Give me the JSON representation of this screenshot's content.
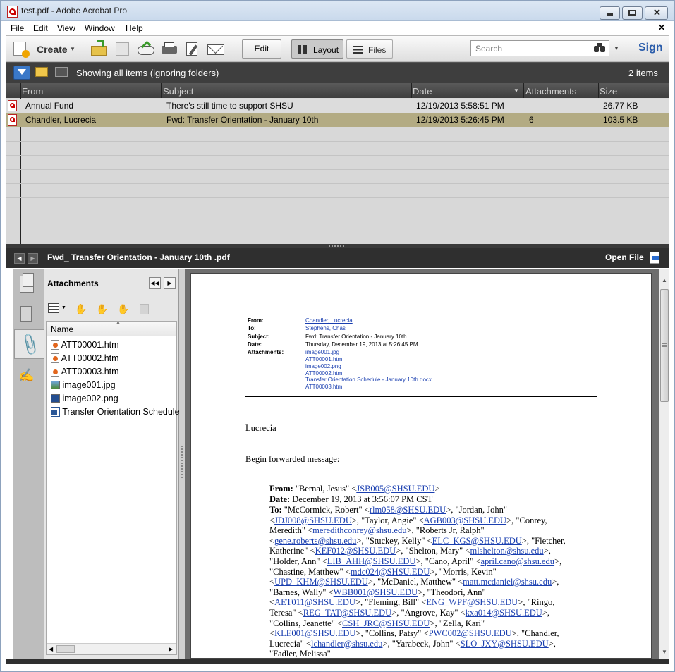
{
  "window": {
    "title": "test.pdf - Adobe Acrobat Pro"
  },
  "menu": [
    "File",
    "Edit",
    "View",
    "Window",
    "Help"
  ],
  "toolbar": {
    "create_label": "Create",
    "edit_label": "Edit",
    "layout_label": "Layout",
    "files_label": "Files",
    "search_placeholder": "Search",
    "sign_label": "Sign"
  },
  "filterbar": {
    "status": "Showing all items (ignoring folders)",
    "count": "2 items"
  },
  "list": {
    "columns": [
      "From",
      "Subject",
      "Date",
      "Attachments",
      "Size"
    ],
    "rows": [
      {
        "from": "Annual Fund",
        "subject": "There's still time to support SHSU",
        "date": "12/19/2013 5:58:51 PM",
        "attachments": "",
        "size": "26.77 KB",
        "selected": false
      },
      {
        "from": "Chandler, Lucrecia",
        "subject": "Fwd: Transfer Orientation - January 10th",
        "date": "12/19/2013 5:26:45 PM",
        "attachments": "6",
        "size": "103.5 KB",
        "selected": true
      }
    ]
  },
  "preview": {
    "filename": "Fwd_ Transfer Orientation - January 10th .pdf",
    "open_label": "Open File"
  },
  "attachments_panel": {
    "title": "Attachments",
    "name_header": "Name",
    "files": [
      {
        "name": "ATT00001.htm",
        "icon": "htm-file-icon"
      },
      {
        "name": "ATT00002.htm",
        "icon": "htm-file-icon"
      },
      {
        "name": "ATT00003.htm",
        "icon": "htm-file-icon"
      },
      {
        "name": "image001.jpg",
        "icon": "jpg-file-icon"
      },
      {
        "name": "image002.png",
        "icon": "png-file-icon"
      },
      {
        "name": "Transfer Orientation Schedule",
        "icon": "word-file-icon"
      }
    ]
  },
  "email": {
    "header": {
      "from_label": "From:",
      "from": "Chandler, Lucrecia",
      "to_label": "To:",
      "to": "Stephens, Chas",
      "subject_label": "Subject:",
      "subject": "Fwd: Transfer Orientation - January 10th",
      "date_label": "Date:",
      "date": "Thursday, December 19, 2013 at 5:26:45 PM",
      "attachments_label": "Attachments:",
      "attachments": [
        "image001.jpg",
        "ATT00001.htm",
        "image002.png",
        "ATT00002.htm",
        "Transfer Orientation Schedule - January 10th.docx",
        "ATT00003.htm"
      ]
    },
    "greeting": "Lucrecia",
    "intro": "Begin forwarded message:",
    "fwd_from_label": "From:",
    "fwd_from_name": " \"Bernal, Jesus\" <",
    "fwd_from_email": "JSB005@SHSU.EDU",
    "fwd_date_label": "Date:",
    "fwd_date": " December 19, 2013 at 3:56:07 PM CST",
    "fwd_to_label": "To:",
    "recipients": [
      [
        "McCormick, Robert",
        "rlm058@SHSU.EDU"
      ],
      [
        "Jordan, John",
        "JDJ008@SHSU.EDU"
      ],
      [
        "Taylor, Angie",
        "AGB003@SHSU.EDU"
      ],
      [
        "Conrey, Meredith",
        "meredithconrey@shsu.edu"
      ],
      [
        "Roberts Jr, Ralph",
        "gene.roberts@shsu.edu"
      ],
      [
        "Stuckey, Kelly",
        "ELC_KGS@SHSU.EDU"
      ],
      [
        "Fletcher, Katherine",
        "KEF012@SHSU.EDU"
      ],
      [
        "Shelton, Mary",
        "mlshelton@shsu.edu"
      ],
      [
        "Holder, Ann",
        "LIB_AHH@SHSU.EDU"
      ],
      [
        "Cano, April",
        "april.cano@shsu.edu"
      ],
      [
        "Chastine, Matthew",
        "mdc024@SHSU.EDU"
      ],
      [
        "Morris, Kevin",
        "UPD_KHM@SHSU.EDU"
      ],
      [
        "McDaniel, Matthew",
        "matt.mcdaniel@shsu.edu"
      ],
      [
        "Barnes, Wally",
        "WBB001@SHSU.EDU"
      ],
      [
        "Theodori, Ann",
        "AET011@SHSU.EDU"
      ],
      [
        "Fleming, Bill",
        "ENG_WPF@SHSU.EDU"
      ],
      [
        "Ringo, Teresa",
        "REG_TAT@SHSU.EDU"
      ],
      [
        "Angrove, Kay",
        "kxa014@SHSU.EDU"
      ],
      [
        "Collins, Jeanette",
        "CSH_JRC@SHSU.EDU"
      ],
      [
        "Zella, Kari",
        "KLE001@SHSU.EDU"
      ],
      [
        "Collins, Patsy",
        "PWC002@SHSU.EDU"
      ],
      [
        "Chandler, Lucrecia",
        "lchandler@shsu.edu"
      ],
      [
        "Yarabeck, John",
        "SLO_JXY@SHSU.EDU"
      ],
      [
        "Fadler, Melissa",
        ""
      ]
    ]
  },
  "colors": {
    "selected_row": "#b3ab83",
    "accent": "#2a5caa"
  }
}
